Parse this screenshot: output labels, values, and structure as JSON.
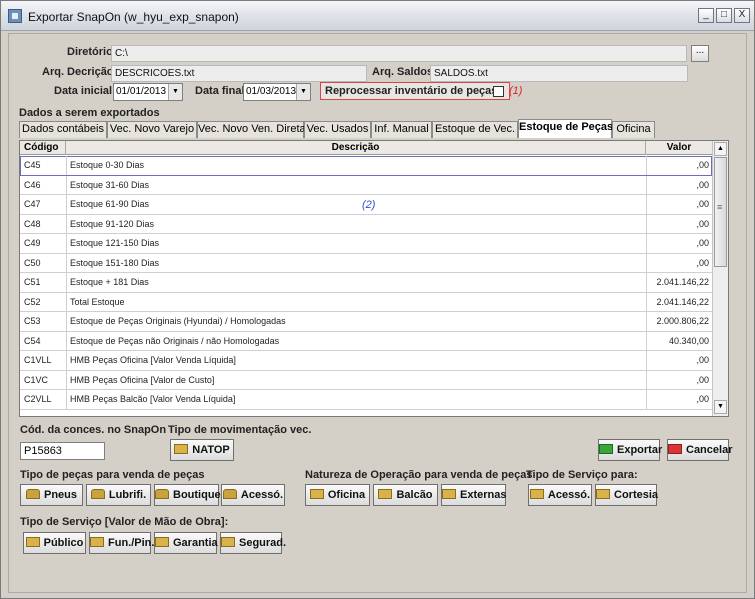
{
  "window": {
    "title": "Exportar SnapOn (w_hyu_exp_snapon)",
    "controls": {
      "minimize": "_",
      "maximize": "□",
      "close": "X"
    }
  },
  "form": {
    "diretorio_label": "Diretório:",
    "diretorio_value": "C:\\",
    "browse_label": "...",
    "arq_descricao_label": "Arq. Decrição:",
    "arq_descricao_value": "DESCRICOES.txt",
    "arq_saldos_label": "Arq. Saldos:",
    "arq_saldos_value": "SALDOS.txt",
    "data_inicial_label": "Data inicial:",
    "data_inicial_value": "01/01/2013",
    "data_final_label": "Data final:",
    "data_final_value": "01/03/2013",
    "reprocessar_label": "Reprocessar inventário de peças?",
    "note_1": "(1)",
    "note_2": "(2)",
    "dados_label": "Dados a serem exportados"
  },
  "tabs": [
    "Dados contábeis",
    "Vec. Novo Varejo",
    "Vec. Novo Ven. Direta",
    "Vec. Usados",
    "Inf. Manual",
    "Estoque de Vec.",
    "Estoque de Peças",
    "Oficina"
  ],
  "active_tab": "Estoque de Peças",
  "grid": {
    "headers": {
      "code": "Código",
      "desc": "Descrição",
      "val": "Valor"
    },
    "rows": [
      {
        "code": "C45",
        "desc": "Estoque 0-30   Dias",
        "val": ",00"
      },
      {
        "code": "C46",
        "desc": "Estoque 31-60   Dias",
        "val": ",00"
      },
      {
        "code": "C47",
        "desc": "Estoque 61-90   Dias",
        "val": ",00"
      },
      {
        "code": "C48",
        "desc": "Estoque 91-120  Dias",
        "val": ",00"
      },
      {
        "code": "C49",
        "desc": "Estoque 121-150 Dias",
        "val": ",00"
      },
      {
        "code": "C50",
        "desc": "Estoque 151-180 Dias",
        "val": ",00"
      },
      {
        "code": "C51",
        "desc": "Estoque + 181   Dias",
        "val": "2.041.146,22"
      },
      {
        "code": "C52",
        "desc": "Total Estoque",
        "val": "2.041.146,22"
      },
      {
        "code": "C53",
        "desc": "Estoque de Peças Originais (Hyundai) / Homologadas",
        "val": "2.000.806,22"
      },
      {
        "code": "C54",
        "desc": "Estoque de Peças não Originais / não Homologadas",
        "val": "40.340,00"
      },
      {
        "code": "C1VLL",
        "desc": "HMB Peças Oficina [Valor Venda Líquida]",
        "val": ",00"
      },
      {
        "code": "C1VC",
        "desc": "HMB Peças Oficina [Valor de Custo]",
        "val": ",00"
      },
      {
        "code": "C2VLL",
        "desc": "HMB Peças Balcão [Valor Venda Líquida]",
        "val": ",00"
      }
    ]
  },
  "bottom": {
    "cod_conces_label": "Cód. da conces. no SnapOn",
    "cod_conces_value": "P15863",
    "tipo_mov_label": "Tipo de movimentação vec.",
    "natop_label": "NATOP",
    "exportar_label": "Exportar",
    "cancelar_label": "Cancelar",
    "tipo_pecas_label": "Tipo de peças para venda de peças",
    "pneus_label": "Pneus",
    "lubrifi_label": "Lubrifi.",
    "boutique_label": "Boutique",
    "acesso_label": "Acessó.",
    "natureza_label": "Natureza de Operação para venda de peças",
    "oficina_label": "Oficina",
    "balcao_label": "Balcão",
    "externas_label": "Externas",
    "tipo_servico_label": "Tipo de Serviço para:",
    "acesso2_label": "Acessó.",
    "cortesia_label": "Cortesia",
    "tipo_servico_mo_label": "Tipo de Serviço [Valor de Mão de Obra]:",
    "publico_label": "Público",
    "funpin_label": "Fun./Pin.",
    "garantia_label": "Garantia",
    "segurad_label": "Segurad."
  },
  "colors": {
    "note_red": "#dd2222",
    "note_blue": "#2a4fd0",
    "window_bg": "#d4d0c8"
  }
}
